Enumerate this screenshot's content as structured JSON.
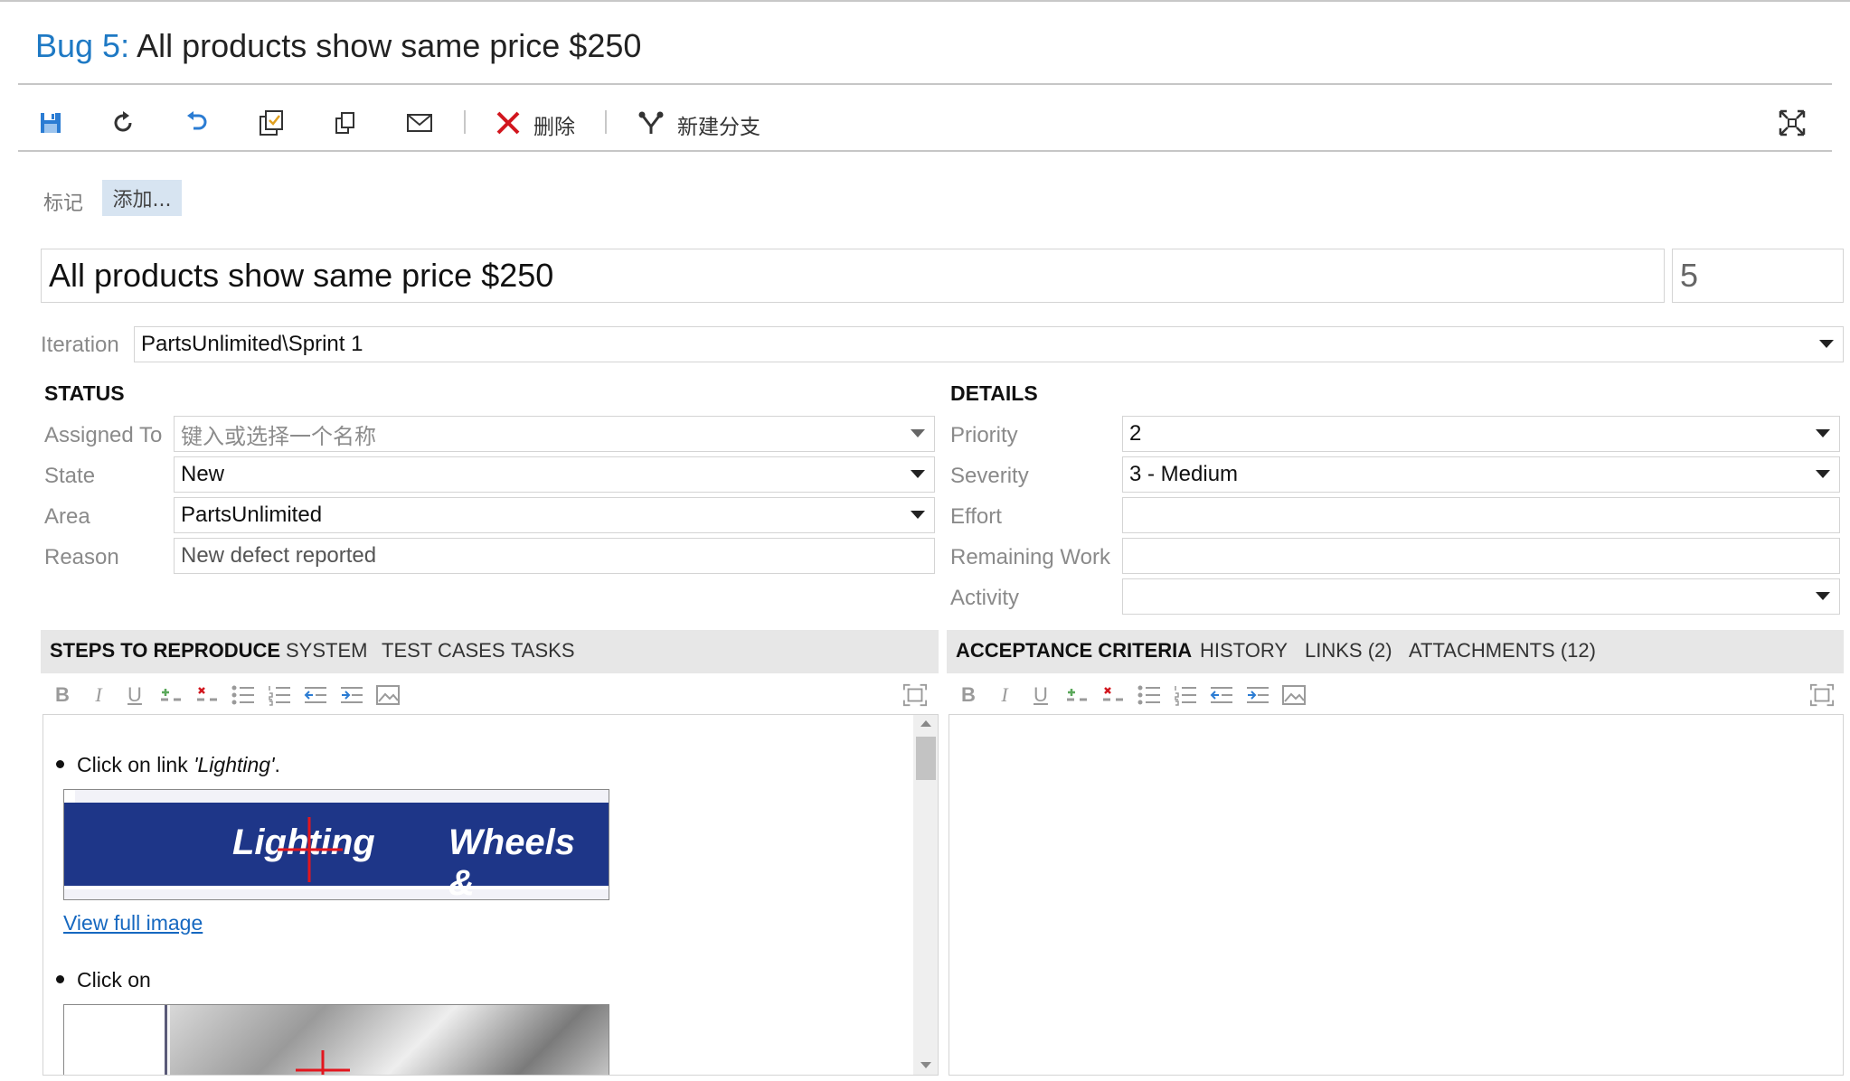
{
  "header": {
    "bug_id": "Bug 5:",
    "title": "All products show same price $250"
  },
  "toolbar": {
    "delete_label": "删除",
    "new_branch_label": "新建分支",
    "icons": [
      "save-icon",
      "refresh-icon",
      "undo-icon",
      "template-icon",
      "copy-icon",
      "email-icon",
      "delete-icon",
      "branch-icon",
      "fullscreen-icon"
    ]
  },
  "tags": {
    "label": "标记",
    "add_label": "添加..."
  },
  "title_field": {
    "value": "All products show same price $250",
    "id": "5"
  },
  "iteration": {
    "label": "Iteration",
    "value": "PartsUnlimited\\Sprint 1"
  },
  "status": {
    "header": "STATUS",
    "assigned_to": {
      "label": "Assigned To",
      "placeholder": "键入或选择一个名称"
    },
    "state": {
      "label": "State",
      "value": "New"
    },
    "area": {
      "label": "Area",
      "value": "PartsUnlimited"
    },
    "reason": {
      "label": "Reason",
      "value": "New defect reported"
    }
  },
  "details": {
    "header": "DETAILS",
    "priority": {
      "label": "Priority",
      "value": "2"
    },
    "severity": {
      "label": "Severity",
      "value": "3 - Medium"
    },
    "effort": {
      "label": "Effort",
      "value": ""
    },
    "remaining_work": {
      "label": "Remaining Work",
      "value": ""
    },
    "activity": {
      "label": "Activity",
      "value": ""
    }
  },
  "left_tabs": [
    "STEPS TO REPRODUCE",
    "SYSTEM",
    "TEST CASES",
    "TASKS"
  ],
  "right_tabs": [
    "ACCEPTANCE CRITERIA",
    "HISTORY",
    "LINKS (2)",
    "ATTACHMENTS (12)"
  ],
  "steps": {
    "step1_prefix": "Click on link ",
    "step1_link": "'Lighting'",
    "step1_suffix": ".",
    "image1_text_a": "Lighting",
    "image1_text_b": "Wheels &",
    "view_full_image": "View full image",
    "step2": "Click on"
  },
  "colors": {
    "accent": "#1e79c4",
    "banner": "#1e3688",
    "delete_red": "#d2161e",
    "tab_bg": "#e7e7e7"
  }
}
